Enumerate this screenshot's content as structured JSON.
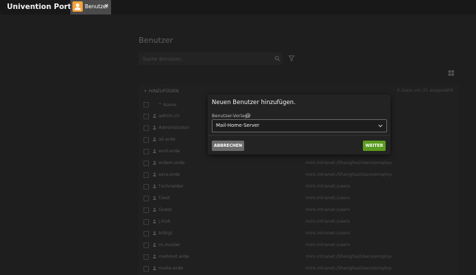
{
  "app": {
    "title": "Univention Portal"
  },
  "tabs": [
    {
      "label": "Benutzer",
      "icon": "user-icon",
      "icon_color": "#f5a33b"
    }
  ],
  "page": {
    "title": "Benutzer",
    "search_placeholder": "Suche Benutzer...",
    "add_label": "HINZUFÜGEN",
    "selection_count": "0 Users von 21 ausgewählt",
    "column_name": "Name"
  },
  "rows": [
    {
      "name": "admin.ch",
      "path": ""
    },
    {
      "name": "Administrator",
      "path": ""
    },
    {
      "name": "ali.erde",
      "path": ""
    },
    {
      "name": "emil.erde",
      "path": ""
    },
    {
      "name": "erdem.erde",
      "path": "miro.intranet:/Shanghai/Users/employees_sha"
    },
    {
      "name": "ezra.erde",
      "path": "miro.intranet:/Shanghai/Users/employees_sha"
    },
    {
      "name": "f.schneider",
      "path": "miro.intranet:/users"
    },
    {
      "name": "f.test",
      "path": "miro.intranet:/users"
    },
    {
      "name": "Guest",
      "path": "miro.intranet:/users"
    },
    {
      "name": "j.kiok",
      "path": "miro.intranet:/users"
    },
    {
      "name": "krbtgt",
      "path": "miro.intranet:/users"
    },
    {
      "name": "m.muster",
      "path": "miro.intranet:/users"
    },
    {
      "name": "mahmut.erde",
      "path": "miro.intranet:/Shanghai/Users/employees_sha"
    },
    {
      "name": "malte.erde",
      "path": "miro.intranet:/Shanghai/Users/employees_sha"
    }
  ],
  "dialog": {
    "title": "Neuen Benutzer hinzufügen.",
    "template_label": "Benutzer-Vorlage",
    "template_value": "Mail-Home-Server",
    "cancel_label": "ABBRECHEN",
    "next_label": "WEITER"
  },
  "colors": {
    "accent": "#5a9b1f",
    "tab_icon": "#f5a33b"
  }
}
